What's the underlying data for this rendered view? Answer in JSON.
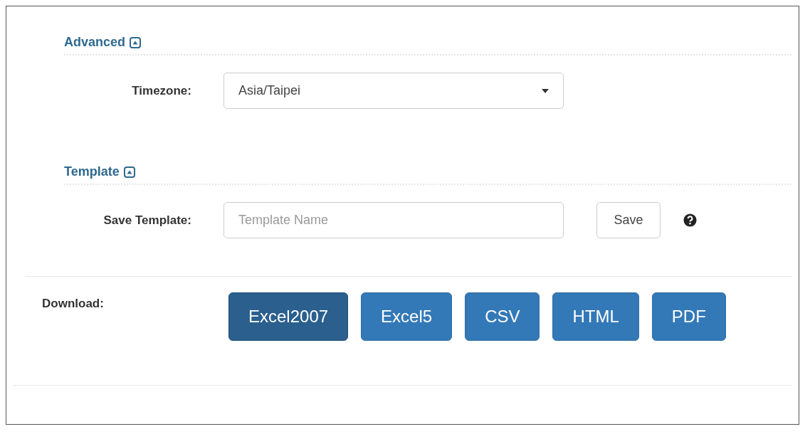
{
  "sections": [
    {
      "title": "Advanced",
      "expanded": true,
      "field": {
        "kind": "select",
        "label": "Timezone:",
        "value": "Asia/Taipei"
      }
    },
    {
      "title": "Template",
      "expanded": true,
      "field": {
        "kind": "text",
        "label": "Save Template:",
        "placeholder": "Template Name",
        "button": "Save",
        "help": true
      }
    }
  ],
  "download": {
    "label": "Download:",
    "buttons": [
      {
        "label": "Excel2007",
        "selected": true
      },
      {
        "label": "Excel5",
        "selected": false
      },
      {
        "label": "CSV",
        "selected": false
      },
      {
        "label": "HTML",
        "selected": false
      },
      {
        "label": "PDF",
        "selected": false
      }
    ]
  }
}
